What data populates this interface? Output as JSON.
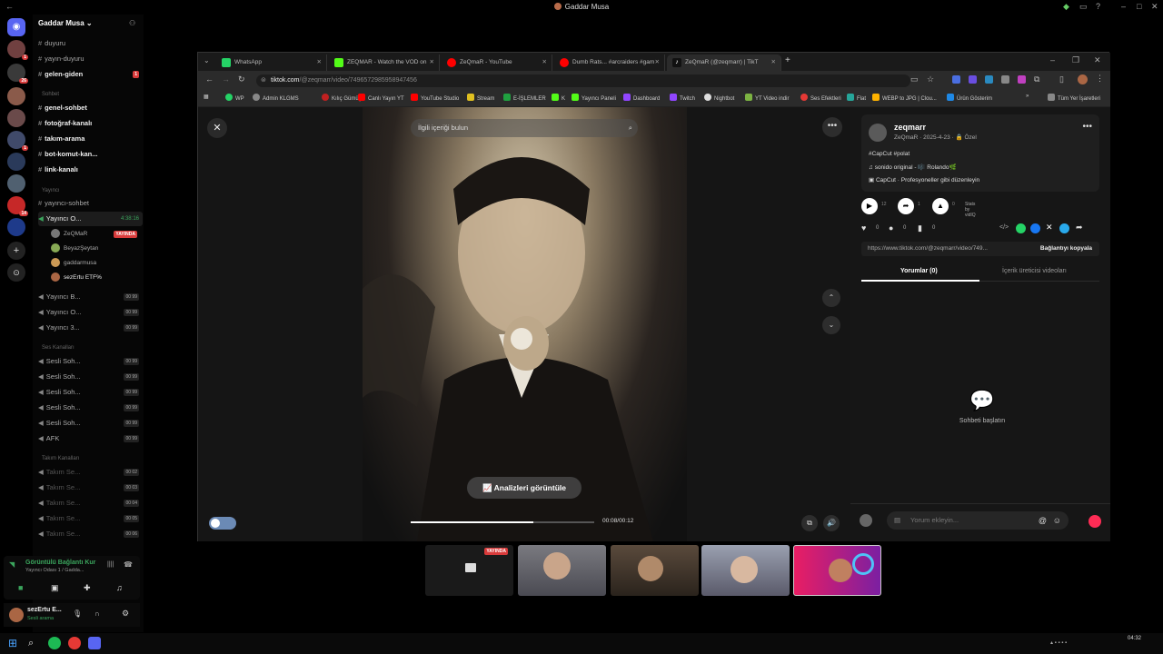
{
  "window": {
    "title": "Gaddar Musa"
  },
  "guilds": [
    {
      "badge": "1"
    },
    {
      "badge": "26"
    },
    {
      "badge": ""
    },
    {
      "badge": ""
    },
    {
      "badge": "1"
    },
    {
      "badge": ""
    },
    {
      "badge": ""
    },
    {
      "badge": "14"
    },
    {
      "badge": ""
    }
  ],
  "server": {
    "name": "Gaddar Musa",
    "categories": {
      "sohbet": "Sohbet",
      "yayinci": "Yayıncı",
      "ses": "Ses Kanalları",
      "takim": "Takım Kanalları"
    },
    "text_channels": [
      {
        "label": "duyuru"
      },
      {
        "label": "yayın-duyuru"
      },
      {
        "label": "gelen-giden",
        "badge": "1"
      },
      {
        "label": "genel-sohbet"
      },
      {
        "label": "fotoğraf-kanalı"
      },
      {
        "label": "takım-arama"
      },
      {
        "label": "bot-komut-kan..."
      },
      {
        "label": "link-kanalı"
      },
      {
        "label": "yayıncı-sohbet"
      }
    ],
    "active_voice": {
      "label": "Yayıncı O...",
      "timer": "4:38:16"
    },
    "members": [
      {
        "name": "ZeQMaR",
        "badge": "YAYINDA"
      },
      {
        "name": "BeyazŞeytan"
      },
      {
        "name": "gaddarmusa"
      },
      {
        "name": "sezErtu ETF%"
      }
    ],
    "yayinci_rooms": [
      {
        "label": "Yayıncı B...",
        "count": "00 99"
      },
      {
        "label": "Yayıncı O...",
        "count": "00 99"
      },
      {
        "label": "Yayıncı 3...",
        "count": "00 99"
      }
    ],
    "voice_channels": [
      {
        "label": "Sesli Soh...",
        "count": "00 99"
      },
      {
        "label": "Sesli Soh...",
        "count": "00 99"
      },
      {
        "label": "Sesli Soh...",
        "count": "00 99"
      },
      {
        "label": "Sesli Soh...",
        "count": "00 99"
      },
      {
        "label": "Sesli Soh...",
        "count": "00 99"
      },
      {
        "label": "AFK",
        "count": "00 99"
      }
    ],
    "team_channels": [
      {
        "label": "Takım Se...",
        "count": "00 02"
      },
      {
        "label": "Takım Se...",
        "count": "00 03"
      },
      {
        "label": "Takım Se...",
        "count": "00 04"
      },
      {
        "label": "Takım Se...",
        "count": "00 05"
      },
      {
        "label": "Takım Se...",
        "count": "00 06"
      }
    ]
  },
  "voice_status": {
    "title": "Görüntülü Bağlantı Kur",
    "subtitle": "Yayıncı Odası 1 / Gadda..."
  },
  "user": {
    "name": "sezErtu E...",
    "status": "Sesli arama"
  },
  "browser": {
    "tabs": [
      {
        "label": "WhatsApp",
        "color": "#25d366"
      },
      {
        "label": "ZEQMAR - Watch the VOD on",
        "color": "#53fc18"
      },
      {
        "label": "ZeQmaR - YouTube",
        "color": "#ff0000"
      },
      {
        "label": "Dumb Rats... #arcraiders #gam",
        "color": "#ff0000"
      },
      {
        "label": "ZeQmaR (@zeqmarr) | TikT",
        "color": "#111111"
      }
    ],
    "url": {
      "host": "tiktok.com",
      "path": "/@zeqmarr/video/7496572985958947456"
    },
    "bookmarks": [
      "WP",
      "Admin KLGMS",
      "Kılıç Gümüş",
      "Canlı Yayın YT",
      "YouTube Studio",
      "Stream",
      "E-İŞLEMLER",
      "K",
      "Yayıncı Paneli",
      "Dashboard",
      "Twitch",
      "Nightbot",
      "YT Video indir",
      "Ses Efektleri",
      "Flat",
      "WEBP to JPG | Clou...",
      "Ürün Gösterim",
      "Tüm Yer İşaretleri"
    ]
  },
  "tiktok": {
    "search_placeholder": "İlgili içeriği bulun",
    "analyze_label": "Analizleri görüntüle",
    "time": "00:08/00:12",
    "progress": 0.67,
    "author": {
      "name": "zeqmarr",
      "sub": "ZeQmaR · 2025-4-23 · 🔒 Özel"
    },
    "hashtags": "#CapCut #polat",
    "sound": "sonido original - 🎼 Rolando🌿",
    "capcut": "CapCut · Profesyoneller gibi düzenleyin",
    "stats": {
      "plays": "12",
      "shares": "1",
      "saves": "0"
    },
    "stats_by": "Stats by vidIQ",
    "reactions": {
      "likes": "0",
      "comments": "0",
      "bookmarks": "0"
    },
    "share_link": "https://www.tiktok.com/@zeqmarr/video/749...",
    "copy_label": "Bağlantıyı kopyala",
    "tab_comments": "Yorumlar (0)",
    "tab_creator": "İçerik üreticisi videoları",
    "empty_label": "Sohbeti başlatın",
    "comment_placeholder": "Yorum ekleyin...",
    "accent": "#fe2c55"
  },
  "streams": [
    {
      "badge": "YAYINDA",
      "color": "#1a1a1a"
    },
    {
      "badge": "",
      "color": "#6a6a70"
    },
    {
      "badge": "",
      "color": "#4a4038"
    },
    {
      "badge": "",
      "color": "#8a8a9a"
    },
    {
      "badge": "",
      "color": "#c2185b"
    }
  ],
  "taskbar": {
    "clock": "04:32"
  }
}
